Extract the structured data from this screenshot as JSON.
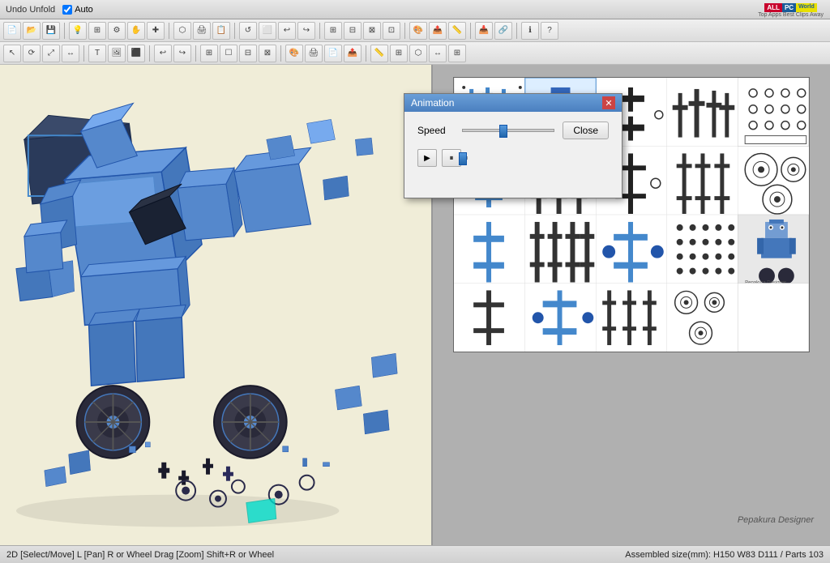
{
  "titlebar": {
    "undo_unfold_label": "Undo Unfold",
    "auto_label": "Auto",
    "logo_all": "ALL",
    "logo_pc": "PC",
    "logo_world": "World",
    "logo_tagline": "Top Apps Best Clips Away"
  },
  "toolbar1": {
    "icons": [
      {
        "name": "new-icon",
        "symbol": "📄"
      },
      {
        "name": "open-icon",
        "symbol": "📂"
      },
      {
        "name": "save-icon",
        "symbol": "💾"
      },
      {
        "name": "lamp-icon",
        "symbol": "💡"
      },
      {
        "name": "settings-icon",
        "symbol": "⚙"
      },
      {
        "name": "info-icon",
        "symbol": "ℹ"
      },
      {
        "name": "hand-icon",
        "symbol": "✋"
      },
      {
        "name": "rotate-icon",
        "symbol": "↺"
      },
      {
        "name": "unfold-icon",
        "symbol": "⬡"
      },
      {
        "name": "print-icon",
        "symbol": "🖨"
      },
      {
        "name": "page-icon",
        "symbol": "📋"
      },
      {
        "name": "zoom-icon",
        "symbol": "🔍"
      },
      {
        "name": "undo-tb-icon",
        "symbol": "↩"
      },
      {
        "name": "expand-icon",
        "symbol": "⬜"
      }
    ]
  },
  "toolbar2": {
    "icons": [
      {
        "name": "cursor-icon",
        "symbol": "↖"
      },
      {
        "name": "rotate2-icon",
        "symbol": "⟳"
      },
      {
        "name": "scale-icon",
        "symbol": "⤢"
      },
      {
        "name": "flip-icon",
        "symbol": "↔"
      },
      {
        "name": "text-icon",
        "symbol": "T"
      },
      {
        "name": "image-icon",
        "symbol": "🖼"
      },
      {
        "name": "cube-icon",
        "symbol": "⬛"
      },
      {
        "name": "undo2-icon",
        "symbol": "↩"
      },
      {
        "name": "redo-icon",
        "symbol": "↪"
      },
      {
        "name": "join-icon",
        "symbol": "⊞"
      },
      {
        "name": "select-icon",
        "symbol": "⬡"
      },
      {
        "name": "parts-icon",
        "symbol": "⊟"
      },
      {
        "name": "split-icon",
        "symbol": "⊠"
      },
      {
        "name": "color-icon",
        "symbol": "🎨"
      },
      {
        "name": "print2-icon",
        "symbol": "🖨"
      },
      {
        "name": "page2-icon",
        "symbol": "📄"
      },
      {
        "name": "export-icon",
        "symbol": "📤"
      },
      {
        "name": "measure-icon",
        "symbol": "📏"
      },
      {
        "name": "grid-icon",
        "symbol": "⊞"
      },
      {
        "name": "help-icon",
        "symbol": "?"
      }
    ]
  },
  "animation_dialog": {
    "title": "Animation",
    "speed_label": "Speed",
    "close_button_label": "Close",
    "play_symbol": "▶",
    "pause_symbol": "⏸"
  },
  "view_2d": {
    "watermark": "Pepakura Designer"
  },
  "status_bar": {
    "left": "2D [Select/Move] L [Pan] R or Wheel Drag [Zoom] Shift+R or Wheel",
    "right": "Assembled size(mm): H150 W83 D111 / Parts 103"
  },
  "colors": {
    "accent_blue": "#4a7fbf",
    "robot_blue": "#5588cc",
    "background_3d": "#f0edd8",
    "background_2d": "#b0b0b0"
  }
}
